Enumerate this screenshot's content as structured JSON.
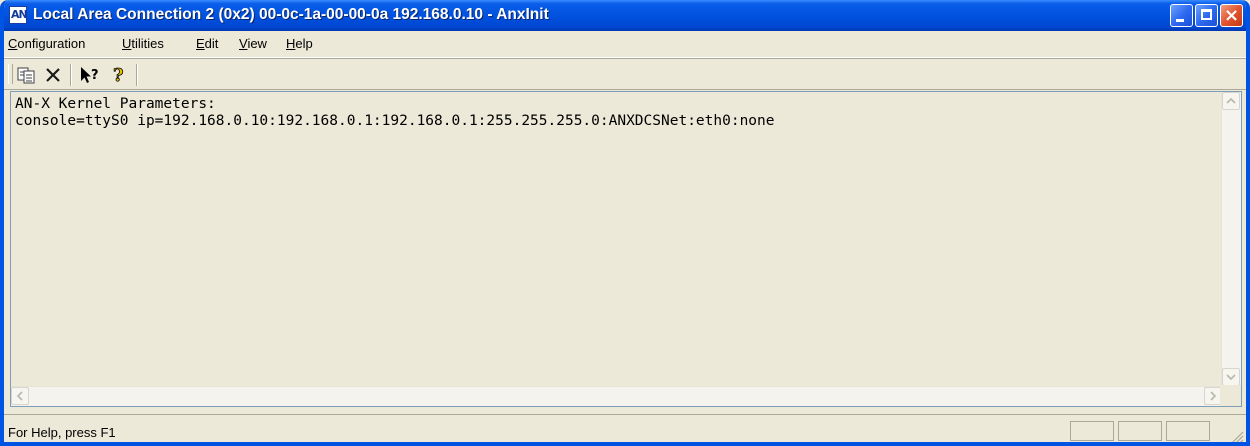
{
  "window": {
    "title": "Local Area Connection 2 (0x2) 00-0c-1a-00-00-0a  192.168.0.10 - AnxInit",
    "app_icon_label": "AN",
    "accent_color": "#0054e3"
  },
  "menubar": {
    "items": [
      {
        "mnemonic": "C",
        "rest": "onfiguration"
      },
      {
        "mnemonic": "U",
        "rest": "tilities"
      },
      {
        "mnemonic": "E",
        "rest": "dit"
      },
      {
        "mnemonic": "V",
        "rest": "iew"
      },
      {
        "mnemonic": "H",
        "rest": "elp"
      }
    ]
  },
  "toolbar": {
    "buttons": [
      "copy-icon",
      "delete-icon",
      "context-help-icon",
      "about-icon"
    ]
  },
  "editor": {
    "lines": [
      "AN-X Kernel Parameters:",
      "console=ttyS0 ip=192.168.0.10:192.168.0.1:192.168.0.1:255.255.255.0:ANXDCSNet:eth0:none"
    ]
  },
  "status": {
    "text": "For Help, press F1"
  }
}
